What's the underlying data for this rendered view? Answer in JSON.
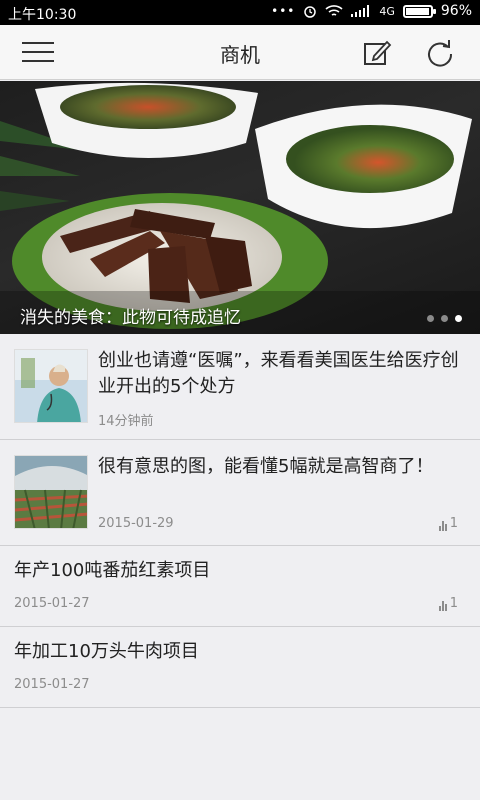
{
  "status_bar": {
    "time": "上午10:30",
    "network": "4G",
    "battery_percent": "96%",
    "battery_level": 0.96
  },
  "header": {
    "title": "商机",
    "icons": [
      "menu-icon",
      "edit-icon",
      "refresh-icon"
    ]
  },
  "banner": {
    "caption": "消失的美食：此物可待成追忆",
    "page_count": 3,
    "active_page": 3
  },
  "articles": [
    {
      "title": "创业也请遵“医嘱”，来看看美国医生给医疗创业开出的5个处方",
      "meta": "14分钟前",
      "count": "",
      "has_thumb": true
    },
    {
      "title": "很有意思的图，能看懂5幅就是高智商了！",
      "meta": "2015-01-29",
      "count": "1",
      "has_thumb": true
    },
    {
      "title": "年产100吨番茄红素项目",
      "meta": "2015-01-27",
      "count": "1",
      "has_thumb": false
    },
    {
      "title": "年加工10万头牛肉项目",
      "meta": "2015-01-27",
      "count": "",
      "has_thumb": false
    }
  ],
  "colors": {
    "background": "#efeff2",
    "header_bg": "#f7f7f7",
    "meta_text": "#8c8c8c"
  }
}
